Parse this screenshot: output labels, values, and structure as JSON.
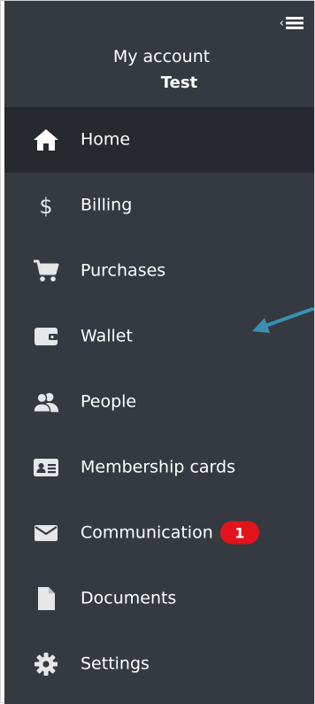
{
  "header": {
    "collapse_icon": "menu-collapse-icon",
    "account_label": "My account",
    "account_name": "Test"
  },
  "nav": {
    "items": [
      {
        "label": "Home",
        "icon": "home-icon",
        "active": true
      },
      {
        "label": "Billing",
        "icon": "dollar-icon"
      },
      {
        "label": "Purchases",
        "icon": "cart-icon"
      },
      {
        "label": "Wallet",
        "icon": "wallet-icon"
      },
      {
        "label": "People",
        "icon": "people-icon"
      },
      {
        "label": "Membership cards",
        "icon": "id-card-icon"
      },
      {
        "label": "Communication",
        "icon": "envelope-icon",
        "badge": "1"
      },
      {
        "label": "Documents",
        "icon": "document-icon"
      },
      {
        "label": "Settings",
        "icon": "gear-icon"
      }
    ]
  },
  "colors": {
    "sidebar_bg": "#343a40",
    "active_bg": "#262a2e",
    "icon": "#e5e7e9",
    "badge": "#e3131b",
    "annotation_arrow": "#3b8fb5"
  }
}
